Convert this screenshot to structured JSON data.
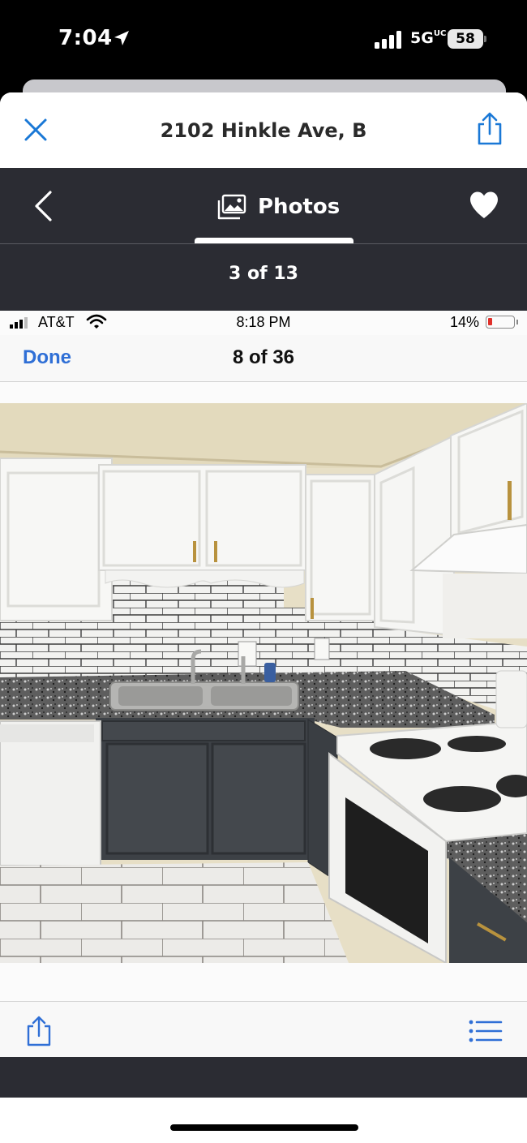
{
  "status_bar": {
    "time": "7:04",
    "network": "5G",
    "network_sup": "UC",
    "battery": "58"
  },
  "sheet": {
    "title": "2102 Hinkle Ave, B"
  },
  "photos_bar": {
    "tab_label": "Photos",
    "counter": "3 of 13"
  },
  "embedded": {
    "carrier": "AT&T",
    "time": "8:18 PM",
    "battery": "14%",
    "done_label": "Done",
    "count": "8 of 36"
  },
  "colors": {
    "dark_bar": "#2b2c33",
    "accent_blue": "#1a78d6",
    "ios_blue": "#2f6fd6"
  },
  "icons": [
    "location-arrow-icon",
    "signal-icon",
    "close-icon",
    "share-icon",
    "chevron-left-icon",
    "photos-icon",
    "heart-icon",
    "wifi-icon",
    "battery-icon",
    "list-icon"
  ]
}
